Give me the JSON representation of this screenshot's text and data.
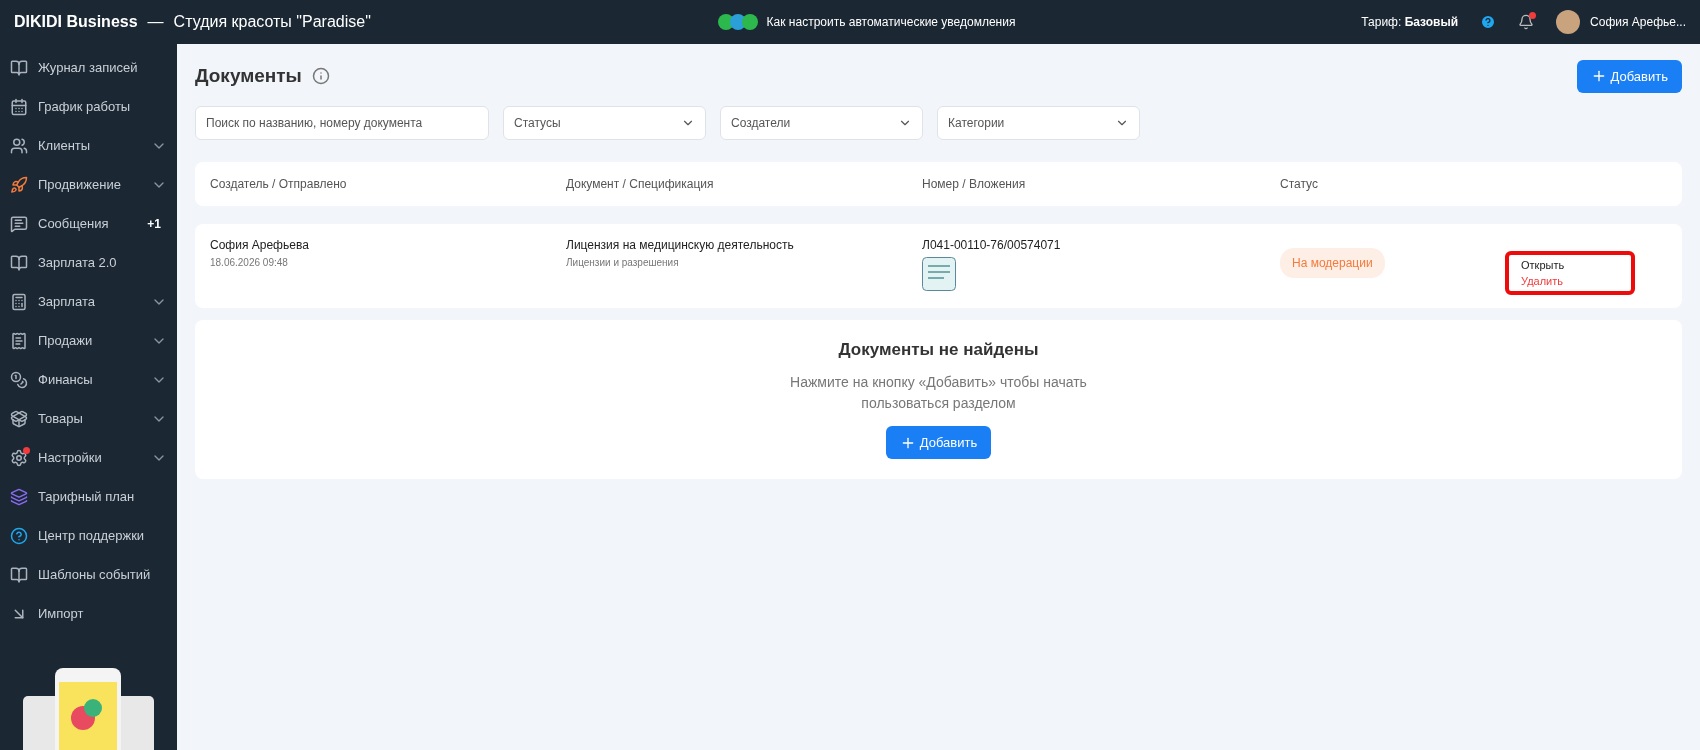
{
  "topbar": {
    "brand": "DIKIDI Business",
    "separator": "—",
    "salon": "Студия красоты \"Paradise\"",
    "hint": "Как настроить автоматические уведомления",
    "tariff": "Тариф: **Базовый**",
    "notifications": true,
    "user": "София Арефье..."
  },
  "sidebar": {
    "items": [
      {
        "label": "Журнал записей",
        "expandable": false
      },
      {
        "label": "График работы",
        "expandable": false
      },
      {
        "label": "Клиенты",
        "expandable": true
      },
      {
        "label": "Продвижение",
        "expandable": true
      },
      {
        "label": "Сообщения",
        "expandable": false,
        "badge": "+1"
      },
      {
        "label": "Зарплата 2.0",
        "expandable": false
      },
      {
        "label": "Зарплата",
        "expandable": true
      },
      {
        "label": "Продажи",
        "expandable": true
      },
      {
        "label": "Финансы",
        "expandable": true
      },
      {
        "label": "Товары",
        "expandable": true
      },
      {
        "label": "Настройки",
        "expandable": true,
        "alert": true
      },
      {
        "label": "Тарифный план",
        "expandable": false
      },
      {
        "label": "Центр поддержки",
        "expandable": false
      },
      {
        "label": "Шаблоны событий",
        "expandable": false
      },
      {
        "label": "Импорт",
        "expandable": false
      }
    ]
  },
  "page": {
    "title": "Документы",
    "add_button": "Добавить"
  },
  "filters": {
    "search": {
      "placeholder": "Поиск по названию, номеру документа"
    },
    "selects": [
      "Статусы",
      "Создатели",
      "Категории"
    ]
  },
  "table": {
    "columns": [
      "Создатель / Отправлено",
      "Документ / Спецификация",
      "Номер / Вложения",
      "Статус"
    ],
    "rows": [
      {
        "creator": "София Арефьева",
        "sent": "18.06.2026 09:48",
        "document": "Лицензия на медицинскую деятельность",
        "specification": "Лицензии и разрешения",
        "number": "Л041-00110-76/00574071",
        "status": "На модерации",
        "actions": [
          "Открыть",
          "Удалить"
        ],
        "highlighted": true
      }
    ]
  },
  "empty": {
    "title": "Документы не найдены",
    "text": "Нажмите на кнопку «Добавить» чтобы начать пользоваться разделом",
    "button": "Добавить"
  }
}
